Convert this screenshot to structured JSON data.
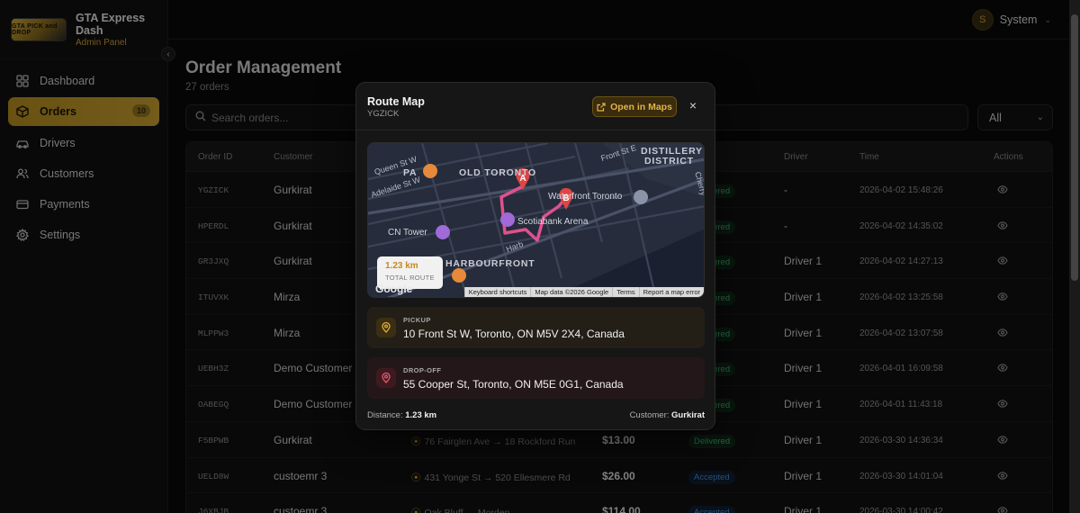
{
  "brand": {
    "logo_text": "GTA PICK and DROP",
    "name": "GTA Express Dash",
    "subtitle": "Admin Panel"
  },
  "nav": {
    "items": [
      {
        "label": "Dashboard",
        "icon": "grid-icon"
      },
      {
        "label": "Orders",
        "icon": "package-icon",
        "active": true,
        "badge": "10"
      },
      {
        "label": "Drivers",
        "icon": "car-icon"
      },
      {
        "label": "Customers",
        "icon": "users-icon"
      },
      {
        "label": "Payments",
        "icon": "credit-card-icon"
      },
      {
        "label": "Settings",
        "icon": "gear-icon"
      }
    ]
  },
  "user": {
    "initial": "S",
    "name": "System"
  },
  "page": {
    "title": "Order Management",
    "subtitle": "27 orders"
  },
  "search": {
    "placeholder": "Search orders..."
  },
  "filter": {
    "value": "All"
  },
  "table": {
    "headers": {
      "id": "Order ID",
      "customer": "Customer",
      "driver": "Driver",
      "time": "Time",
      "actions": "Actions"
    },
    "rows": [
      {
        "id": "YGZICK",
        "customer": "Gurkirat",
        "route": "",
        "amount": "",
        "status": "Delivered",
        "driver": "-",
        "time": "2026-04-02 15:48:26"
      },
      {
        "id": "HPERDL",
        "customer": "Gurkirat",
        "route": "",
        "amount": "",
        "status": "Delivered",
        "driver": "-",
        "time": "2026-04-02 14:35:02"
      },
      {
        "id": "GR3JXQ",
        "customer": "Gurkirat",
        "route": "",
        "amount": "",
        "status": "Delivered",
        "driver": "Driver 1",
        "time": "2026-04-02 14:27:13"
      },
      {
        "id": "ITUVXK",
        "customer": "Mirza",
        "route": "",
        "amount": "",
        "status": "Delivered",
        "driver": "Driver 1",
        "time": "2026-04-02 13:25:58"
      },
      {
        "id": "MLPPW3",
        "customer": "Mirza",
        "route": "",
        "amount": "",
        "status": "Delivered",
        "driver": "Driver 1",
        "time": "2026-04-02 13:07:58"
      },
      {
        "id": "UEBH3Z",
        "customer": "Demo Customer 1",
        "route": "",
        "amount": "",
        "status": "Delivered",
        "driver": "Driver 1",
        "time": "2026-04-01 16:09:58"
      },
      {
        "id": "OABEGQ",
        "customer": "Demo Customer 1",
        "route": "",
        "amount": "",
        "status": "Delivered",
        "driver": "Driver 1",
        "time": "2026-04-01 11:43:18"
      },
      {
        "id": "F5BPWB",
        "customer": "Gurkirat",
        "route": "76 Fairglen Ave → 18 Rockford Run",
        "amount": "$13.00",
        "status": "Delivered",
        "driver": "Driver 1",
        "time": "2026-03-30 14:36:34"
      },
      {
        "id": "UELD8W",
        "customer": "custoemr 3",
        "route": "431 Yonge St → 520 Ellesmere Rd",
        "amount": "$26.00",
        "status": "Accepted",
        "driver": "Driver 1",
        "time": "2026-03-30 14:01:04"
      },
      {
        "id": "J6XBJB",
        "customer": "custoemr 3",
        "route": "Oak Bluff → Morden",
        "amount": "$114.00",
        "status": "Accepted",
        "driver": "Driver 1",
        "time": "2026-03-30 14:00:42"
      }
    ]
  },
  "modal": {
    "title": "Route Map",
    "order_id": "YGZICK",
    "open_label": "Open in Maps",
    "map": {
      "labels": {
        "queen": "Queen St W",
        "adelaide": "Adelaide St W",
        "front": "Front St E",
        "distillery": "DISTILLERY",
        "district": "DISTRICT",
        "old_toronto": "OLD TORONTO",
        "pa": "PA",
        "waterfront": "Waterfront Toronto",
        "scotiabank": "Scotiabank Arena",
        "cn_tower": "CN Tower",
        "harbourfront": "HARBOURFRONT",
        "harb": "Harb",
        "cherry": "Cherry",
        "google": "Google"
      },
      "marker_a": "A",
      "marker_b": "B",
      "distance_value": "1.23 km",
      "distance_label": "TOTAL ROUTE",
      "footer": [
        "Keyboard shortcuts",
        "Map data ©2026 Google",
        "Terms",
        "Report a map error"
      ]
    },
    "pickup": {
      "label": "PICKUP",
      "address": "10 Front St W, Toronto, ON M5V 2X4, Canada"
    },
    "dropoff": {
      "label": "DROP-OFF",
      "address": "55 Cooper St, Toronto, ON M5E 0G1, Canada"
    },
    "distance_label": "Distance:",
    "distance_value": "1.23 km",
    "customer_label": "Customer:",
    "customer_value": "Gurkirat"
  },
  "colors": {
    "accent": "#d2a833",
    "delivered": "#4cc27a",
    "accepted": "#4e92d8",
    "route_line": "#e0508f",
    "marker": "#e04444"
  }
}
